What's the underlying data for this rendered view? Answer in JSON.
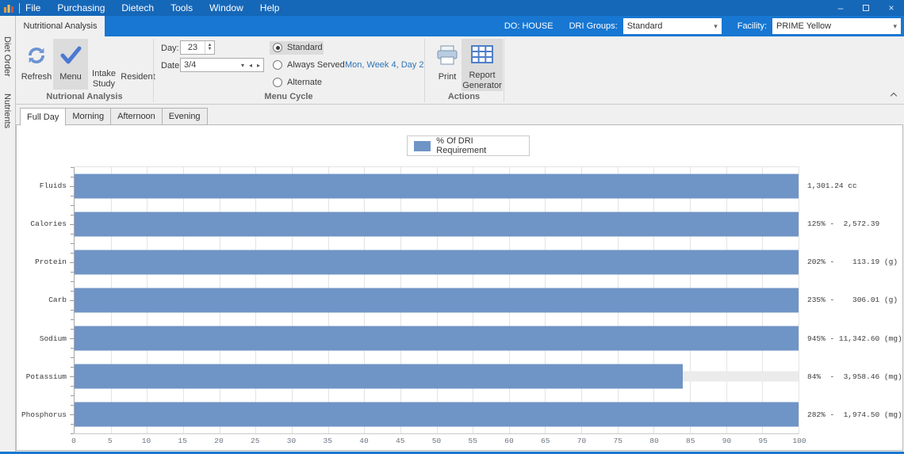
{
  "titlebar": {
    "menus": [
      "File",
      "Purchasing",
      "Dietech",
      "Tools",
      "Window",
      "Help"
    ],
    "minimize": "–",
    "close": "×"
  },
  "ribbon_bar": {
    "active_tab": "Nutritional Analysis",
    "do_label": "DO: HOUSE",
    "dri_groups_label": "DRI Groups:",
    "dri_groups_value": "Standard",
    "facility_label": "Facility:",
    "facility_value": "PRIME Yellow",
    "caret": "▾"
  },
  "ribbon": {
    "nutritional_group": {
      "refresh": "Refresh",
      "menu": "Menu",
      "intake_study": "Intake Study",
      "resident": "Resident",
      "label": "Nutrional Analysis"
    },
    "menu_cycle_group": {
      "day_label": "Day:",
      "day_value": "23",
      "date_label": "Date:",
      "date_value": "3/4",
      "radios": [
        "Standard",
        "Always Served",
        "Alternate"
      ],
      "selected_radio": "Standard",
      "cycle_info": "Mon, Week 4, Day 2",
      "label": "Menu Cycle"
    },
    "actions_group": {
      "print": "Print",
      "report_generator": "Report Generator",
      "label": "Actions"
    }
  },
  "side_tabs": [
    "Diet Order",
    "Nutrients"
  ],
  "view_tabs": [
    "Full Day",
    "Morning",
    "Afternoon",
    "Evening"
  ],
  "active_view_tab": "Full Day",
  "chart_data": {
    "type": "bar",
    "orientation": "horizontal",
    "legend": "% Of DRI Requirement",
    "legend_position": "top-center",
    "categories": [
      "Fluids",
      "Calories",
      "Protein",
      "Carb",
      "Sodium",
      "Potassium",
      "Phosphorus"
    ],
    "values": [
      100,
      100,
      100,
      100,
      100,
      84,
      100
    ],
    "value_labels": [
      "1,301.24 cc",
      "125% -  2,572.39",
      "202% -    113.19 (g)",
      "235% -    306.01 (g)",
      "945% - 11,342.60 (mg)",
      "84%  -  3,958.46 (mg)",
      "282% -  1,974.50 (mg)"
    ],
    "percent_of_dri": [
      null,
      125,
      202,
      235,
      945,
      84,
      282
    ],
    "amounts": [
      "1,301.24",
      "2,572.39",
      "113.19",
      "306.01",
      "11,342.60",
      "3,958.46",
      "1,974.50"
    ],
    "units": [
      "cc",
      "",
      "(g)",
      "(g)",
      "(mg)",
      "(mg)",
      "(mg)"
    ],
    "xlim": [
      0,
      100
    ],
    "x_ticks": [
      0,
      5,
      10,
      15,
      20,
      25,
      30,
      35,
      40,
      45,
      50,
      55,
      60,
      65,
      70,
      75,
      80,
      85,
      90,
      95,
      100
    ],
    "grid": true,
    "bar_color": "#6f94c6",
    "track_color": "#ebebeb"
  }
}
